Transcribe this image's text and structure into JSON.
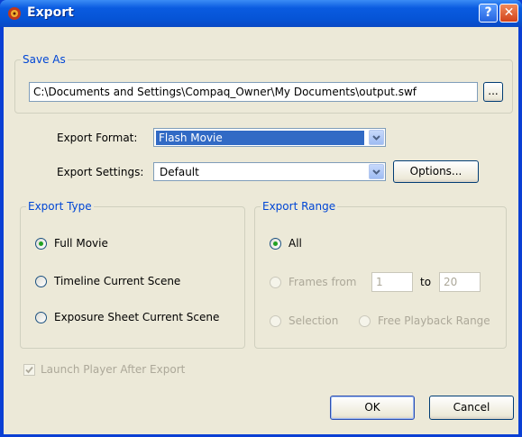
{
  "window": {
    "title": "Export",
    "help_label": "?",
    "close_label": "✕"
  },
  "save_as": {
    "legend": "Save As",
    "path_value": "C:\\Documents and Settings\\Compaq_Owner\\My Documents\\output.swf",
    "browse_label": "..."
  },
  "export_format": {
    "label": "Export Format:",
    "selected": "Flash Movie"
  },
  "export_settings": {
    "label": "Export Settings:",
    "selected": "Default",
    "options_button": "Options..."
  },
  "export_type": {
    "legend": "Export Type",
    "options": [
      {
        "label": "Full Movie",
        "selected": true
      },
      {
        "label": "Timeline Current Scene",
        "selected": false
      },
      {
        "label": "Exposure Sheet Current Scene",
        "selected": false
      }
    ]
  },
  "export_range": {
    "legend": "Export Range",
    "all_label": "All",
    "frames_from_label": "Frames from",
    "from_value": "1",
    "to_label": "to",
    "to_value": "20",
    "selection_label": "Selection",
    "free_playback_label": "Free Playback Range"
  },
  "launch_player": {
    "label": "Launch Player After Export",
    "checked": true,
    "enabled": false
  },
  "buttons": {
    "ok": "OK",
    "cancel": "Cancel"
  },
  "colors": {
    "titlebar": "#0a5be0",
    "group_legend": "#0046d5",
    "selection_highlight": "#316ac5",
    "dialog_bg": "#ece9d8"
  }
}
